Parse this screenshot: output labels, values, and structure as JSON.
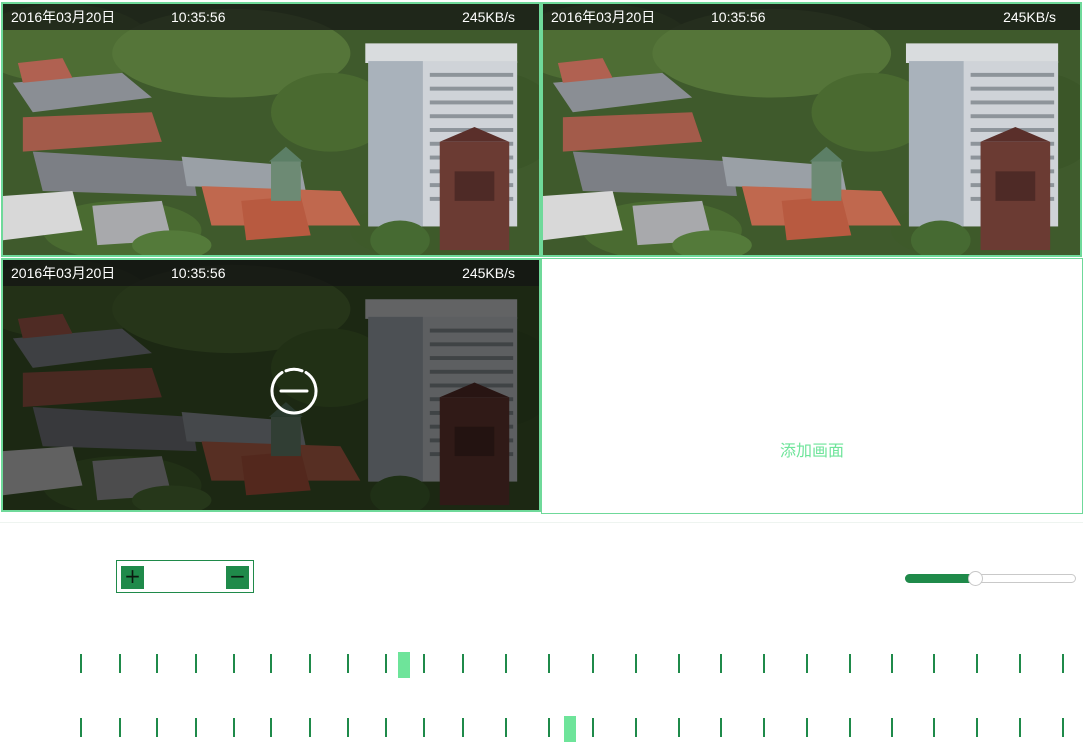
{
  "panes": [
    {
      "date": "2016年03月20日",
      "time": "10:35:56",
      "rate": "245KB/s"
    },
    {
      "date": "2016年03月20日",
      "time": "10:35:56",
      "rate": "245KB/s"
    },
    {
      "date": "2016年03月20日",
      "time": "10:35:56",
      "rate": "245KB/s"
    }
  ],
  "add_pane": {
    "label": "添加画面"
  },
  "zoom": {
    "plus_label": "+",
    "minus_label": "−"
  },
  "slider": {
    "value_percent": 41
  },
  "colors": {
    "accent": "#1f8a4a",
    "highlight": "#6ee49a",
    "pane_border": "#6fd99a"
  },
  "icons": {
    "remove": "minus-circle-icon",
    "zoom_in": "plus-icon",
    "zoom_out": "minus-icon"
  },
  "timeline": {
    "tick_count": 24,
    "tracks": [
      {
        "cursor_index": 8
      },
      {
        "cursor_index": 12
      }
    ]
  }
}
